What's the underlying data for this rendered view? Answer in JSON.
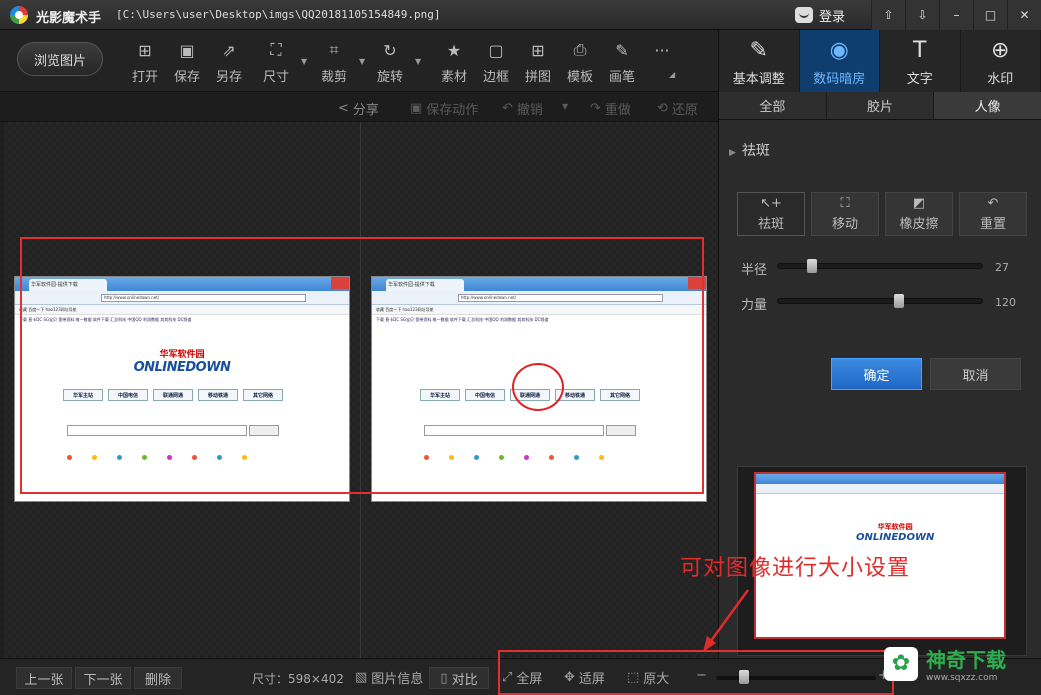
{
  "window": {
    "app_name": "光影魔术手",
    "file_path": "[C:\\Users\\user\\Desktop\\imgs\\QQ20181105154849.png]",
    "login": "登录",
    "btns": [
      "⇧",
      "⇩",
      "–",
      "□",
      "✕"
    ]
  },
  "toolbar": {
    "browse": "浏览图片",
    "tools": [
      {
        "label": "打开",
        "icon": "⊞"
      },
      {
        "label": "保存",
        "icon": "▣"
      },
      {
        "label": "另存",
        "icon": "⇗"
      },
      {
        "label": "尺寸",
        "icon": "⛶"
      },
      {
        "label": "裁剪",
        "icon": "⌗"
      },
      {
        "label": "旋转",
        "icon": "↻"
      },
      {
        "label": "素材",
        "icon": "★"
      },
      {
        "label": "边框",
        "icon": "▢"
      },
      {
        "label": "拼图",
        "icon": "⊞"
      },
      {
        "label": "模板",
        "icon": "⎙"
      },
      {
        "label": "画笔",
        "icon": "✎"
      },
      {
        "label": "",
        "icon": "···"
      }
    ]
  },
  "right_tabs": [
    {
      "label": "基本调整",
      "icon": "✎"
    },
    {
      "label": "数码暗房",
      "icon": "◉"
    },
    {
      "label": "文字",
      "icon": "T"
    },
    {
      "label": "水印",
      "icon": "⊕"
    }
  ],
  "subbar": {
    "share": "分享",
    "save_action": "保存动作",
    "undo": "撤销",
    "redo": "重做",
    "restore": "还原"
  },
  "panel": {
    "tabs": [
      "全部",
      "胶片",
      "人像"
    ],
    "section": "祛斑",
    "tools": [
      "祛斑",
      "移动",
      "橡皮擦",
      "重置"
    ],
    "radius_label": "半径",
    "radius_value": "27",
    "radius_level": 0.15,
    "strength_label": "力量",
    "strength_value": "120",
    "strength_level": 0.6,
    "ok": "确定",
    "cancel": "取消"
  },
  "web": {
    "tab": "华军软件园-提供下载",
    "url": "http://www.onlinedown.net/",
    "fav": "收藏   百度一下   hao123网址导航",
    "links": "下载 直卡DC  SG宝贝  宽带资料  唯一数据  软件下载  汇总科技  中国QQ  利润数据  其其科技  DC频道",
    "cn_logo": "华军软件园",
    "en_logo": "ONLINEDOWN",
    "buttons": [
      "华军主站",
      "中国电信",
      "联通网通",
      "移动铁通",
      "其它网络"
    ]
  },
  "annotation": "可对图像进行大小设置",
  "status": {
    "prev": "上一张",
    "next": "下一张",
    "delete": "删除",
    "size": "尺寸：598×402",
    "info": "图片信息",
    "compare": "对比",
    "fullscreen": "全屏",
    "fit": "适屏",
    "original": "原大",
    "minus": "−",
    "plus": "+",
    "zoom_level": 0.15
  },
  "watermark": {
    "name": "神奇下载",
    "url": "www.sqxzz.com"
  },
  "colors": {
    "accent": "#1f66c4",
    "annotation": "#e02b2b",
    "active_tab": "#0f3e6e"
  }
}
